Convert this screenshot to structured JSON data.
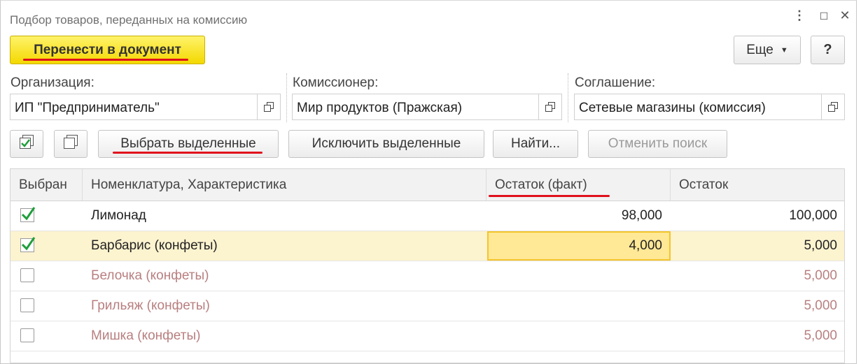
{
  "window": {
    "title": "Подбор товаров, переданных на комиссию",
    "controls": {
      "more": "⋮",
      "maximize": "☐",
      "close": "✕"
    }
  },
  "toolbar": {
    "primary_label": "Перенести в документ",
    "more_label": "Еще",
    "help_label": "?"
  },
  "fields": {
    "organization": {
      "label": "Организация:",
      "value": "ИП \"Предприниматель\""
    },
    "commissioner": {
      "label": "Комиссионер:",
      "value": "Мир продуктов (Пражская)"
    },
    "agreement": {
      "label": "Соглашение:",
      "value": "Сетевые магазины (комиссия)"
    }
  },
  "actions": {
    "select_selected": "Выбрать выделенные",
    "exclude_selected": "Исключить выделенные",
    "find": "Найти...",
    "cancel_search": "Отменить поиск"
  },
  "table": {
    "columns": [
      "Выбран",
      "Номенклатура, Характеристика",
      "Остаток (факт)",
      "Остаток"
    ],
    "rows": [
      {
        "checked": true,
        "name": "Лимонад",
        "fact": "98,000",
        "rest": "100,000"
      },
      {
        "checked": true,
        "name": "Барбарис (конфеты)",
        "fact": "4,000",
        "rest": "5,000"
      },
      {
        "checked": false,
        "name": "Белочка (конфеты)",
        "fact": "",
        "rest": "5,000"
      },
      {
        "checked": false,
        "name": "Грильяж (конфеты)",
        "fact": "",
        "rest": "5,000"
      },
      {
        "checked": false,
        "name": "Мишка (конфеты)",
        "fact": "",
        "rest": "5,000"
      }
    ]
  },
  "colors": {
    "primary_button": "#f3d800",
    "highlight_underline": "#e0101c",
    "selected_row": "#fcf3cf",
    "inactive_text": "#b87f80",
    "check_green": "#1e9e3a"
  },
  "icons": {
    "check_all": "check-all-icon",
    "uncheck_all": "uncheck-all-icon",
    "open_field": "open-window-icon"
  }
}
